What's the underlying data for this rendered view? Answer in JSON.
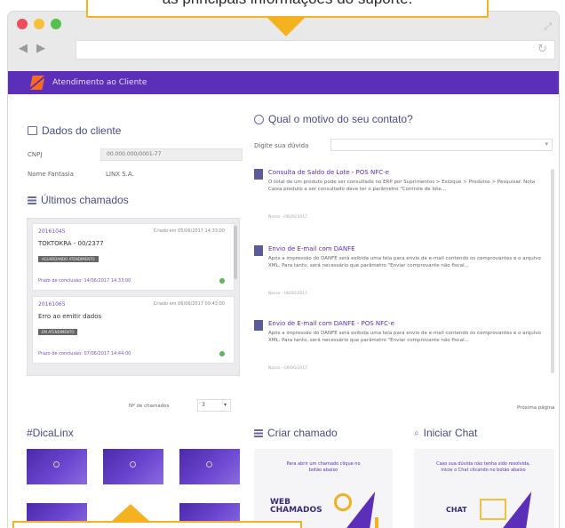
{
  "callout_top": {
    "text": "as principais informações do suporte."
  },
  "browser": {
    "reload_icon": "reload-icon",
    "back_icon": "chevron-left-icon",
    "forward_icon": "chevron-right-icon"
  },
  "app": {
    "title": "Atendimento ao Cliente",
    "accent": "#5b2fb8",
    "logo_color": "#ff6a1a"
  },
  "client": {
    "title": "Dados do cliente",
    "cnpj_label": "CNPJ",
    "cnpj_value": "00.000.000/0001-77",
    "trade_name_label": "Nome Fantasia",
    "trade_name_value": "LINX S.A."
  },
  "last_calls": {
    "title": "Últimos chamados",
    "items": [
      {
        "id": "20161045",
        "date": "Criado em 05/06/2017 14:33:00",
        "subject": "TOKTOKRA - 00/2377",
        "tag": "AGUARDANDO ATENDIMENTO",
        "deadline": "Prazo de conclusão: 14/06/2017 14:33:00"
      },
      {
        "id": "20161065",
        "date": "Criado em 06/06/2017 09:43:00",
        "subject": "Erro ao emitir dados",
        "tag": "EM ATENDIMENTO",
        "deadline": "Prazo de conclusão: 07/06/2017 14:44:00"
      }
    ],
    "pager_label": "Nº de chamados",
    "pager_value": "3"
  },
  "contact": {
    "title": "Qual o motivo do seu contato?",
    "search_label": "Digite sua dúvida",
    "faq": [
      {
        "title": "Consulta de Saldo de Lote - POS NFC-e",
        "body": "O total de um produto pode ser consultado no ERP por Suprimentos > Estoque > Produtos > Pesquisar. Nota Caixa produto a ser consultado deve ter o parâmetro \"Controle de lote...",
        "meta": "Nosso - 08/06/2017"
      },
      {
        "title": "Envio de E-mail com DANFE",
        "body": "Após a impressão do DANFE será exibida uma tela para envio de e-mail contendo os comprovantes e o arquivo XML. Para tanto, será necessário que parâmetro \"Enviar comprovante não fiscal...",
        "meta": "Nosso - 08/06/2017"
      },
      {
        "title": "Envio de E-mail com DANFE - POS NFC-e",
        "body": "Após a impressão do DANFE será exibida uma tela para envio de e-mail contendo os comprovantes e o arquivo XML. Para tanto, será necessário que parâmetro \"Enviar comprovante não fiscal...",
        "meta": "Nosso - 08/06/2017"
      }
    ],
    "next_page": "Próxima página"
  },
  "tips": {
    "title": "#DicaLinx"
  },
  "create_call": {
    "title": "Criar chamado",
    "text": "Para abrir um chamado clique no botão abaixo",
    "logo": "WEB CHAMADOS"
  },
  "chat": {
    "title": "Iniciar Chat",
    "text": "Caso sua dúvida não tenha sido resolvida, inicie o Chat clicando no botão abaixo",
    "logo": "CHAT"
  }
}
